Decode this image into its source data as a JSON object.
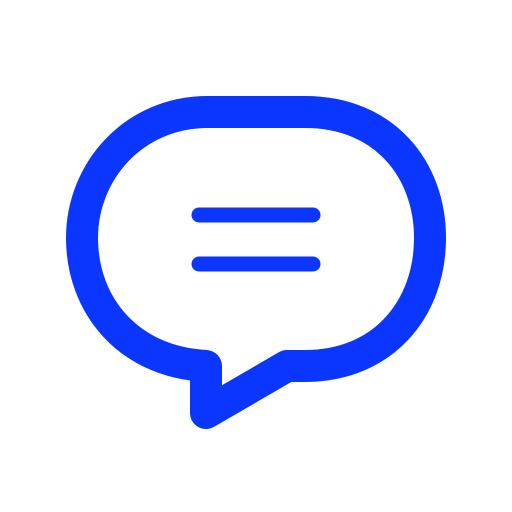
{
  "icon": {
    "name": "chat-bubble-icon",
    "lines_icon": "text-lines-icon",
    "color": "#0A36FF",
    "background": "#FFFFFF"
  }
}
